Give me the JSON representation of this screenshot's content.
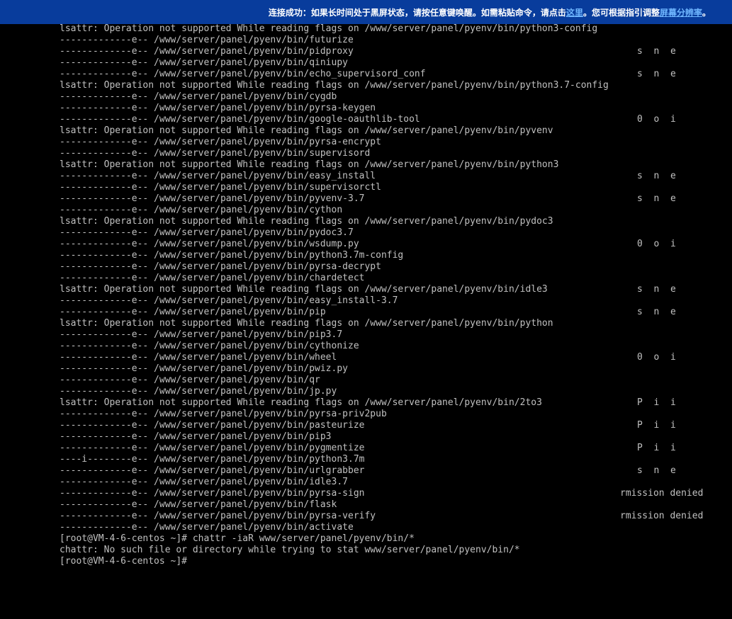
{
  "banner": {
    "text_before": "连接成功：如果长时间处于黑屏状态，请按任意键唤醒。如需粘贴命令，请点击",
    "link_here": "这里",
    "text_middle": "。您可根据指引调整",
    "link_resolution": "屏幕分辨率",
    "text_after": "。"
  },
  "terminal": {
    "lines": [
      {
        "text": "lsattr: Operation not supported While reading flags on /www/server/panel/pyenv/bin/python3-config",
        "right": ""
      },
      {
        "text": "-------------e-- /www/server/panel/pyenv/bin/futurize",
        "right": ""
      },
      {
        "text": "-------------e-- /www/server/panel/pyenv/bin/pidproxy",
        "right": "s  n  e"
      },
      {
        "text": "-------------e-- /www/server/panel/pyenv/bin/qiniupy",
        "right": ""
      },
      {
        "text": "-------------e-- /www/server/panel/pyenv/bin/echo_supervisord_conf",
        "right": "s  n  e"
      },
      {
        "text": "lsattr: Operation not supported While reading flags on /www/server/panel/pyenv/bin/python3.7-config",
        "right": ""
      },
      {
        "text": "-------------e-- /www/server/panel/pyenv/bin/cygdb",
        "right": ""
      },
      {
        "text": "-------------e-- /www/server/panel/pyenv/bin/pyrsa-keygen",
        "right": ""
      },
      {
        "text": "-------------e-- /www/server/panel/pyenv/bin/google-oauthlib-tool",
        "right": "0  o  i"
      },
      {
        "text": "lsattr: Operation not supported While reading flags on /www/server/panel/pyenv/bin/pyvenv",
        "right": ""
      },
      {
        "text": "-------------e-- /www/server/panel/pyenv/bin/pyrsa-encrypt",
        "right": ""
      },
      {
        "text": "-------------e-- /www/server/panel/pyenv/bin/supervisord",
        "right": ""
      },
      {
        "text": "lsattr: Operation not supported While reading flags on /www/server/panel/pyenv/bin/python3",
        "right": ""
      },
      {
        "text": "-------------e-- /www/server/panel/pyenv/bin/easy_install",
        "right": "s  n  e"
      },
      {
        "text": "-------------e-- /www/server/panel/pyenv/bin/supervisorctl",
        "right": ""
      },
      {
        "text": "-------------e-- /www/server/panel/pyenv/bin/pyvenv-3.7",
        "right": "s  n  e"
      },
      {
        "text": "-------------e-- /www/server/panel/pyenv/bin/cython",
        "right": ""
      },
      {
        "text": "lsattr: Operation not supported While reading flags on /www/server/panel/pyenv/bin/pydoc3",
        "right": ""
      },
      {
        "text": "-------------e-- /www/server/panel/pyenv/bin/pydoc3.7",
        "right": ""
      },
      {
        "text": "-------------e-- /www/server/panel/pyenv/bin/wsdump.py",
        "right": "0  o  i"
      },
      {
        "text": "-------------e-- /www/server/panel/pyenv/bin/python3.7m-config",
        "right": ""
      },
      {
        "text": "-------------e-- /www/server/panel/pyenv/bin/pyrsa-decrypt",
        "right": ""
      },
      {
        "text": "-------------e-- /www/server/panel/pyenv/bin/chardetect",
        "right": ""
      },
      {
        "text": "lsattr: Operation not supported While reading flags on /www/server/panel/pyenv/bin/idle3",
        "right": "s  n  e"
      },
      {
        "text": "-------------e-- /www/server/panel/pyenv/bin/easy_install-3.7",
        "right": ""
      },
      {
        "text": "-------------e-- /www/server/panel/pyenv/bin/pip",
        "right": "s  n  e"
      },
      {
        "text": "lsattr: Operation not supported While reading flags on /www/server/panel/pyenv/bin/python",
        "right": ""
      },
      {
        "text": "-------------e-- /www/server/panel/pyenv/bin/pip3.7",
        "right": ""
      },
      {
        "text": "-------------e-- /www/server/panel/pyenv/bin/cythonize",
        "right": ""
      },
      {
        "text": "-------------e-- /www/server/panel/pyenv/bin/wheel",
        "right": "0  o  i"
      },
      {
        "text": "-------------e-- /www/server/panel/pyenv/bin/pwiz.py",
        "right": ""
      },
      {
        "text": "-------------e-- /www/server/panel/pyenv/bin/qr",
        "right": ""
      },
      {
        "text": "-------------e-- /www/server/panel/pyenv/bin/jp.py",
        "right": ""
      },
      {
        "text": "lsattr: Operation not supported While reading flags on /www/server/panel/pyenv/bin/2to3",
        "right": "P  i  i"
      },
      {
        "text": "-------------e-- /www/server/panel/pyenv/bin/pyrsa-priv2pub",
        "right": ""
      },
      {
        "text": "-------------e-- /www/server/panel/pyenv/bin/pasteurize",
        "right": "P  i  i"
      },
      {
        "text": "-------------e-- /www/server/panel/pyenv/bin/pip3",
        "right": ""
      },
      {
        "text": "-------------e-- /www/server/panel/pyenv/bin/pygmentize",
        "right": "P  i  i"
      },
      {
        "text": "----i--------e-- /www/server/panel/pyenv/bin/python3.7m",
        "right": ""
      },
      {
        "text": "-------------e-- /www/server/panel/pyenv/bin/urlgrabber",
        "right": "s  n  e"
      },
      {
        "text": "-------------e-- /www/server/panel/pyenv/bin/idle3.7",
        "right": ""
      },
      {
        "text": "-------------e-- /www/server/panel/pyenv/bin/pyrsa-sign",
        "right": "rmission denied"
      },
      {
        "text": "-------------e-- /www/server/panel/pyenv/bin/flask",
        "right": ""
      },
      {
        "text": "-------------e-- /www/server/panel/pyenv/bin/pyrsa-verify",
        "right": "rmission denied"
      },
      {
        "text": "-------------e-- /www/server/panel/pyenv/bin/activate",
        "right": ""
      },
      {
        "text": "[root@VM-4-6-centos ~]# chattr -iaR www/server/panel/pyenv/bin/*",
        "right": ""
      },
      {
        "text": "chattr: No such file or directory while trying to stat www/server/panel/pyenv/bin/*",
        "right": ""
      },
      {
        "text": "[root@VM-4-6-centos ~]#",
        "right": ""
      }
    ]
  }
}
